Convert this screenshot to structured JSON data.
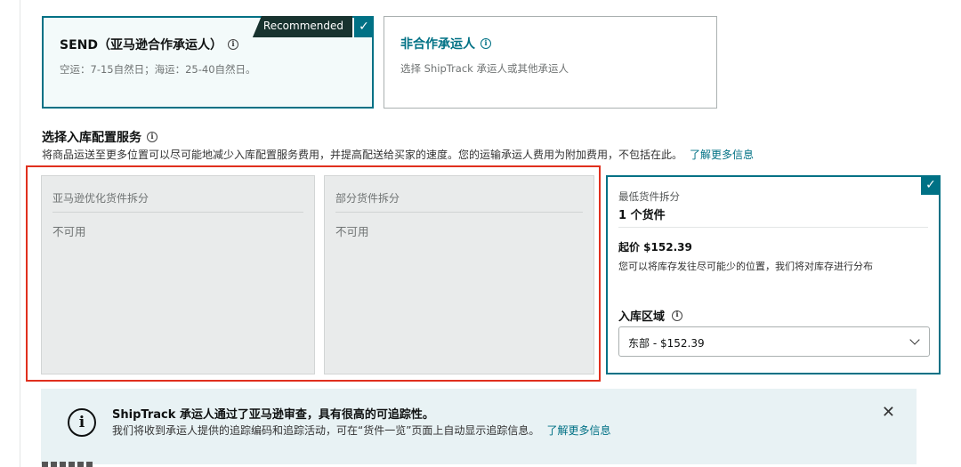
{
  "carriers": {
    "send": {
      "title": "SEND（亚马逊合作承运人）",
      "badge": "Recommended",
      "desc": "空运：7-15自然日；海运：25-40自然日。"
    },
    "non_partner": {
      "title": "非合作承运人",
      "desc": "选择 ShipTrack 承运人或其他承运人"
    }
  },
  "section": {
    "title": "选择入库配置服务",
    "desc": "将商品运送至更多位置可以尽可能地减少入库配置服务费用，并提高配送给买家的速度。您的运输承运人费用为附加费用，不包括在此。",
    "learn_more": "了解更多信息"
  },
  "options": [
    {
      "title": "亚马逊优化货件拆分",
      "status": "不可用"
    },
    {
      "title": "部分货件拆分",
      "status": "不可用"
    }
  ],
  "selected_option": {
    "label": "最低货件拆分",
    "value": "1 个货件",
    "price": "起价 $152.39",
    "note": "您可以将库存发往尽可能少的位置，我们将对库存进行分布",
    "region_label": "入库区域",
    "region_value": "东部 - $152.39"
  },
  "banner": {
    "title": "ShipTrack 承运人通过了亚马逊审查，具有很高的可追踪性。",
    "text": "我们将收到承运人提供的追踪编码和追踪活动，可在“货件一览”页面上自动显示追踪信息。",
    "learn_more": "了解更多信息"
  },
  "icons": {
    "info": "info-icon",
    "check": "check-icon",
    "close": "close-icon",
    "chevron": "chevron-down-icon"
  },
  "colors": {
    "accent": "#007185",
    "highlight": "#e0301e",
    "badge_bg": "#18332f",
    "banner_bg": "#e8f2f4"
  }
}
